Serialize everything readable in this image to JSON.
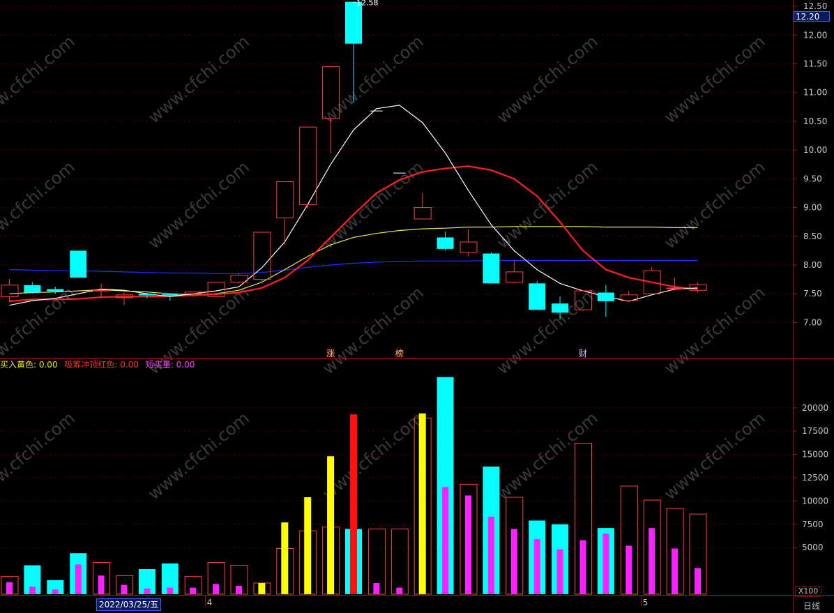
{
  "chart": {
    "price_tag": "12.20",
    "high_label": "12.58",
    "scale_unit": "X100",
    "cursor_date": "2022/03/25/五",
    "period": "日线",
    "indicator_legend": [
      {
        "text": "买入黄色: 0.00",
        "color": "#e8e800"
      },
      {
        "text": "吸筹冲顶红色: 0.00",
        "color": "#ff3030"
      },
      {
        "text": "短买量: 0.00",
        "color": "#ff40ff"
      }
    ],
    "event_markers": [
      {
        "label": "涨",
        "bar_index": 14
      },
      {
        "label": "榜",
        "bar_index": 17
      },
      {
        "label": "财",
        "bar_index": 25
      }
    ],
    "month_markers": [
      {
        "label": "4",
        "bar_index": 9
      },
      {
        "label": "5",
        "bar_index": 28
      }
    ],
    "watermark": "www.cfchi.com"
  },
  "chart_data": [
    {
      "type": "candlestick",
      "price_axis": {
        "min": 6.75,
        "max": 12.55,
        "ticks": [
          "7.00",
          "7.50",
          "8.00",
          "8.50",
          "9.00",
          "9.50",
          "10.00",
          "10.50",
          "11.00",
          "11.50",
          "12.00",
          "12.50"
        ]
      },
      "colors": {
        "up": "#ff4040",
        "down": "#00ffff",
        "ma5": "#ffffff",
        "ma10": "#ff2020",
        "ma20": "#e8e850",
        "ma60": "#2030ff"
      },
      "candles": [
        {
          "open": 7.45,
          "high": 7.75,
          "low": 7.35,
          "close": 7.65
        },
        {
          "open": 7.65,
          "high": 7.7,
          "low": 7.5,
          "close": 7.52
        },
        {
          "open": 7.58,
          "high": 7.62,
          "low": 7.5,
          "close": 7.54
        },
        {
          "open": 8.25,
          "high": 8.25,
          "low": 7.78,
          "close": 7.78
        },
        {
          "open": 7.56,
          "high": 7.68,
          "low": 7.42,
          "close": 7.56
        },
        {
          "open": 7.43,
          "high": 7.52,
          "low": 7.3,
          "close": 7.48
        },
        {
          "open": 7.5,
          "high": 7.52,
          "low": 7.42,
          "close": 7.47
        },
        {
          "open": 7.49,
          "high": 7.51,
          "low": 7.38,
          "close": 7.47
        },
        {
          "open": 7.5,
          "high": 7.53,
          "low": 7.45,
          "close": 7.53
        },
        {
          "open": 7.45,
          "high": 7.7,
          "low": 7.45,
          "close": 7.7
        },
        {
          "open": 7.7,
          "high": 7.85,
          "low": 7.68,
          "close": 7.82
        },
        {
          "open": 7.75,
          "high": 8.57,
          "low": 7.72,
          "close": 8.57
        },
        {
          "open": 8.82,
          "high": 9.45,
          "low": 8.35,
          "close": 9.45
        },
        {
          "open": 9.05,
          "high": 10.4,
          "low": 8.98,
          "close": 10.4
        },
        {
          "open": 10.55,
          "high": 11.45,
          "low": 9.95,
          "close": 11.45
        },
        {
          "open": 12.58,
          "high": 12.58,
          "low": 10.82,
          "close": 11.85
        },
        {
          "open": 10.68,
          "high": 10.68,
          "low": 10.68,
          "close": 10.68
        },
        {
          "open": 9.6,
          "high": 9.6,
          "low": 9.6,
          "close": 9.6
        },
        {
          "open": 8.8,
          "high": 9.25,
          "low": 8.8,
          "close": 9.0
        },
        {
          "open": 8.48,
          "high": 8.58,
          "low": 8.25,
          "close": 8.28
        },
        {
          "open": 8.22,
          "high": 8.62,
          "low": 8.15,
          "close": 8.4
        },
        {
          "open": 8.2,
          "high": 8.22,
          "low": 7.67,
          "close": 7.68
        },
        {
          "open": 7.7,
          "high": 8.08,
          "low": 7.68,
          "close": 7.88
        },
        {
          "open": 7.68,
          "high": 7.72,
          "low": 7.22,
          "close": 7.22
        },
        {
          "open": 7.33,
          "high": 7.45,
          "low": 7.05,
          "close": 7.17
        },
        {
          "open": 7.22,
          "high": 7.55,
          "low": 7.2,
          "close": 7.55
        },
        {
          "open": 7.52,
          "high": 7.65,
          "low": 7.1,
          "close": 7.37
        },
        {
          "open": 7.38,
          "high": 7.55,
          "low": 7.35,
          "close": 7.48
        },
        {
          "open": 7.5,
          "high": 7.97,
          "low": 7.5,
          "close": 7.9
        },
        {
          "open": 7.6,
          "high": 7.78,
          "low": 7.55,
          "close": 7.6
        },
        {
          "open": 7.56,
          "high": 7.7,
          "low": 7.52,
          "close": 7.66
        }
      ],
      "ma5": [
        7.3,
        7.38,
        7.42,
        7.5,
        7.58,
        7.56,
        7.5,
        7.45,
        7.5,
        7.55,
        7.62,
        7.95,
        8.4,
        9.05,
        9.75,
        10.35,
        10.72,
        10.78,
        10.48,
        9.95,
        9.3,
        8.7,
        8.25,
        7.92,
        7.68,
        7.55,
        7.45,
        7.37,
        7.48,
        7.58,
        7.6
      ],
      "ma10": [
        7.37,
        7.4,
        7.4,
        7.41,
        7.44,
        7.45,
        7.45,
        7.46,
        7.47,
        7.49,
        7.52,
        7.6,
        7.78,
        8.08,
        8.48,
        8.88,
        9.25,
        9.48,
        9.62,
        9.68,
        9.72,
        9.65,
        9.5,
        9.2,
        8.75,
        8.25,
        7.92,
        7.78,
        7.7,
        7.62,
        7.58
      ],
      "ma20": [
        7.5,
        7.52,
        7.53,
        7.55,
        7.57,
        7.55,
        7.53,
        7.5,
        7.48,
        7.5,
        7.56,
        7.7,
        7.92,
        8.15,
        8.35,
        8.48,
        8.55,
        8.6,
        8.63,
        8.64,
        8.66,
        8.66,
        8.67,
        8.67,
        8.67,
        8.67,
        8.66,
        8.66,
        8.66,
        8.65,
        8.65
      ],
      "ma60": [
        7.92,
        7.91,
        7.9,
        7.9,
        7.89,
        7.88,
        7.87,
        7.86,
        7.86,
        7.85,
        7.85,
        7.87,
        7.91,
        7.96,
        8.0,
        8.03,
        8.05,
        8.06,
        8.07,
        8.07,
        8.07,
        8.08,
        8.08,
        8.08,
        8.08,
        8.08,
        8.08,
        8.08,
        8.08,
        8.08,
        8.08
      ]
    },
    {
      "type": "bar",
      "volume_axis": {
        "min": 0,
        "max": 23500,
        "ticks": [
          "5000",
          "7500",
          "10000",
          "12500",
          "15000",
          "17500",
          "20000"
        ]
      },
      "colors": {
        "up": "#ff4040",
        "down": "#00ffff",
        "buy_yellow": "#ffff00",
        "top_red": "#ff1010",
        "short_buy": "#ff20ff"
      },
      "volumes": [
        1900,
        3100,
        1500,
        4400,
        3400,
        2000,
        2700,
        3300,
        1900,
        3400,
        3100,
        1200,
        4900,
        6800,
        7200,
        7000,
        7000,
        7000,
        18900,
        23300,
        11800,
        13700,
        10400,
        7900,
        7500,
        16200,
        7100,
        11600,
        10100,
        9200,
        8600
      ],
      "signal_bars": [
        {
          "index": 11,
          "kind": "buy_yellow",
          "value": 1200
        },
        {
          "index": 12,
          "kind": "buy_yellow",
          "value": 7700
        },
        {
          "index": 13,
          "kind": "buy_yellow",
          "value": 10400
        },
        {
          "index": 14,
          "kind": "buy_yellow",
          "value": 14800
        },
        {
          "index": 15,
          "kind": "top_red",
          "value": 19300
        },
        {
          "index": 18,
          "kind": "buy_yellow",
          "value": 19400
        }
      ],
      "short_buy": [
        1300,
        800,
        500,
        3200,
        2000,
        1000,
        600,
        700,
        700,
        1100,
        900,
        0,
        0,
        0,
        0,
        0,
        1200,
        700,
        0,
        11500,
        10600,
        8300,
        7000,
        5900,
        4800,
        5800,
        6500,
        5200,
        7100,
        4900,
        2800
      ]
    }
  ]
}
